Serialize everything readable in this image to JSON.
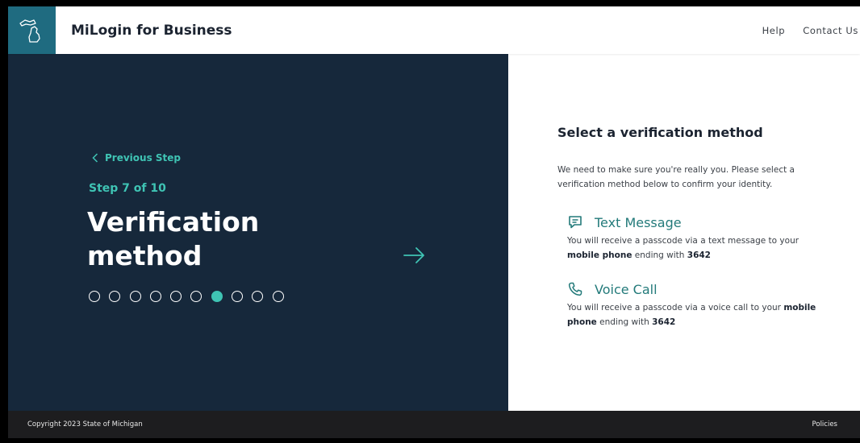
{
  "header": {
    "brand": "MiLogin for Business",
    "nav": [
      {
        "label": "Help"
      },
      {
        "label": "Contact Us"
      }
    ]
  },
  "left": {
    "previous_step": "Previous Step",
    "step_text": "Step 7 of 10",
    "title_line1": "Verification",
    "title_line2": "method",
    "progress": {
      "current_step": 7,
      "total_steps": 10
    }
  },
  "right": {
    "heading": "Select a verification method",
    "description": "We need to make sure you're really you. Please select a verification method below to confirm your identity.",
    "options": [
      {
        "label": "Text Message",
        "icon": "message-icon",
        "text_pre": "You will receive a passcode via a text message to your ",
        "text_bold": "mobile phone",
        "text_mid": " ending with ",
        "text_end": "3642"
      },
      {
        "label": "Voice Call",
        "icon": "phone-icon",
        "text_pre": "You will receive a passcode via a voice call to your ",
        "text_bold": "mobile phone",
        "text_mid": " ending with ",
        "text_end": "3642"
      }
    ]
  },
  "footer": {
    "copyright": "Copyright 2023 State of Michigan",
    "policies": "Policies"
  },
  "colors": {
    "navy": "#16283b",
    "teal": "#3fc4b4",
    "logo_bg": "#1f6b80",
    "option_teal": "#237a7a",
    "footer_bg": "#1d1d1f"
  }
}
